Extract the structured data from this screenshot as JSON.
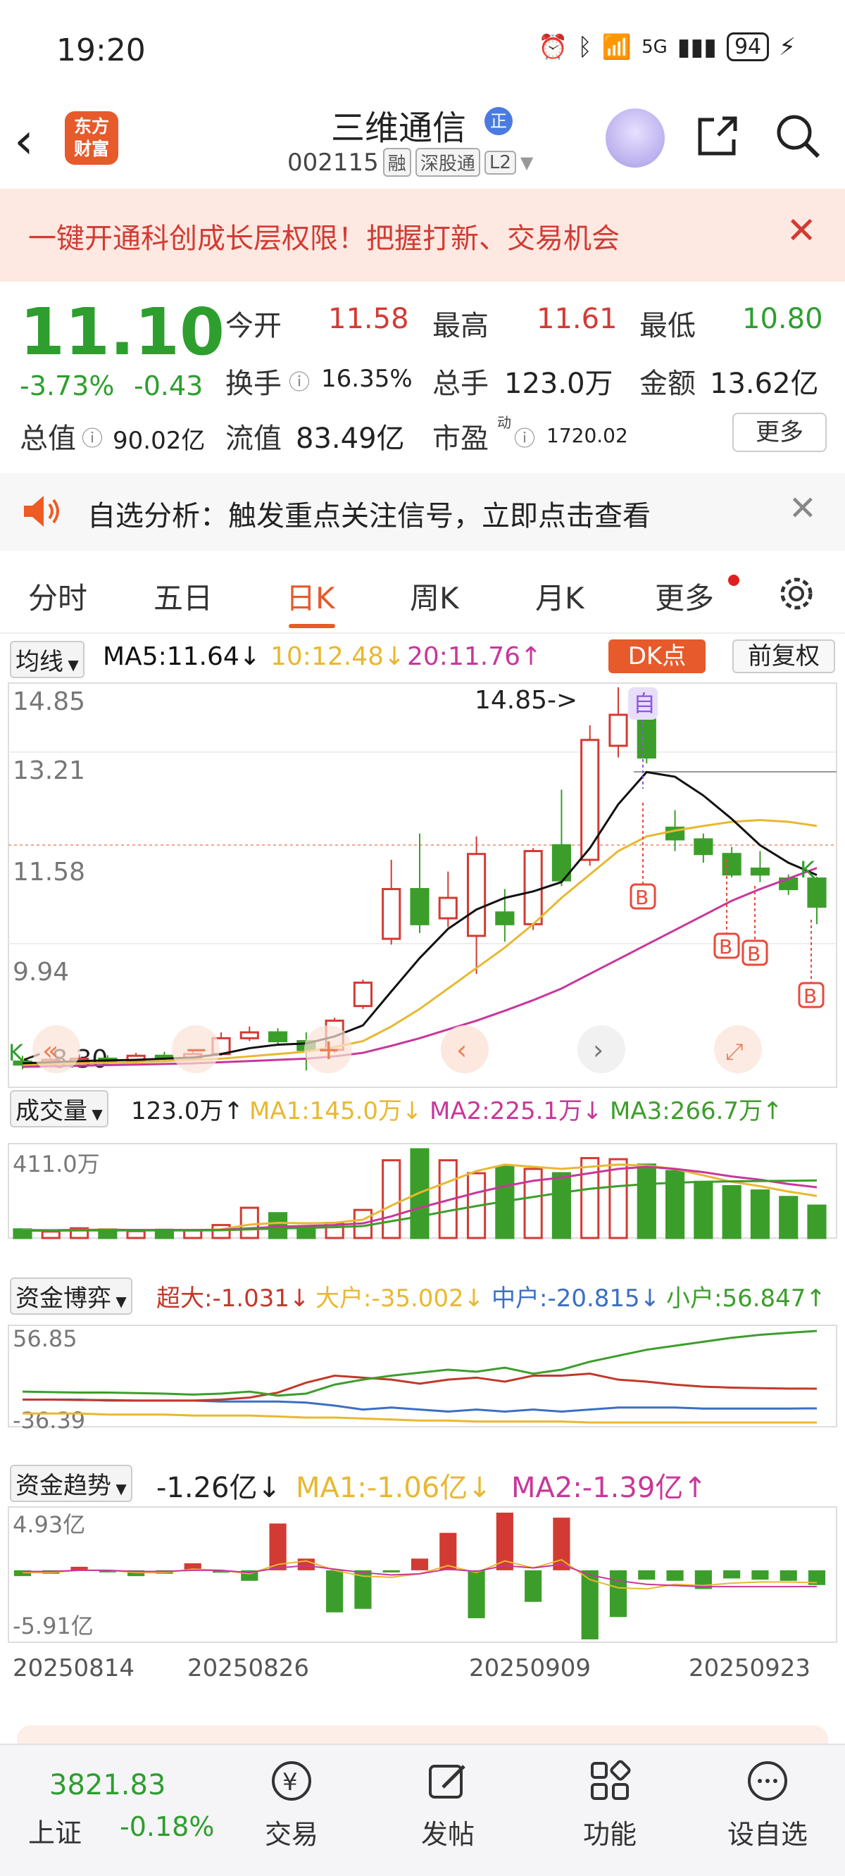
{
  "status_bar": {
    "time": "19:20",
    "network": "5G",
    "battery": "94"
  },
  "header": {
    "back_label": "‹",
    "logo_line1": "东方",
    "logo_line2": "财富",
    "stock_name": "三维通信",
    "zheng_badge": "正",
    "stock_code": "002115",
    "tag_rong": "融",
    "tag_sgt": "深股通",
    "tag_l2": "L2"
  },
  "banner": {
    "text": "一键开通科创成长层权限！把握打新、交易机会",
    "close": "✕"
  },
  "quote": {
    "price": "11.10",
    "change_pct": "-3.73%",
    "change_abs": "-0.43",
    "open_label": "今开",
    "open": "11.58",
    "high_label": "最高",
    "high": "11.61",
    "low_label": "最低",
    "low": "10.80",
    "turnover_label": "换手",
    "turnover": "16.35%",
    "volume_label": "总手",
    "volume": "123.0万",
    "amount_label": "金额",
    "amount": "13.62亿",
    "mktcap_label": "总值",
    "mktcap": "90.02亿",
    "float_label": "流值",
    "float_cap": "83.49亿",
    "pe_label": "市盈",
    "pe_sup": "动",
    "pe": "1720.02",
    "more": "更多"
  },
  "notice": {
    "text": "自选分析：触发重点关注信号，立即点击查看",
    "close": "✕"
  },
  "tabs": [
    {
      "label": "分时"
    },
    {
      "label": "五日"
    },
    {
      "label": "日K"
    },
    {
      "label": "周K"
    },
    {
      "label": "月K"
    },
    {
      "label": "更多"
    }
  ],
  "ma_bar": {
    "selector": "均线",
    "ma5": "MA5:11.64↓",
    "ma10": "10:12.48↓",
    "ma20": "20:11.76↑",
    "dk": "DK点",
    "fuquan": "前复权"
  },
  "kline": {
    "y_ticks": [
      "14.85",
      "13.21",
      "11.58",
      "9.94"
    ],
    "high_note": "14.85->",
    "low_note": "<-8.30",
    "self_tag": "自",
    "k_tag": "K",
    "b_tag": "B",
    "colors": {
      "up": "#d23b34",
      "down": "#3c9e2a",
      "ma5": "#111111",
      "ma10": "#e8b830",
      "ma20": "#c8379a"
    }
  },
  "volume": {
    "selector": "成交量",
    "current": "123.0万↑",
    "ma1": "MA1:145.0万↓",
    "ma2": "MA2:225.1万↓",
    "ma3": "MA3:266.7万↑",
    "y_top": "411.0万"
  },
  "fund_game": {
    "selector": "资金博弈",
    "super": "超大:-1.031↓",
    "big": "大户:-35.002↓",
    "mid": "中户:-20.815↓",
    "small": "小户:56.847↑",
    "y_top": "56.85",
    "y_bottom": "-36.39"
  },
  "fund_trend": {
    "selector": "资金趋势",
    "current": "-1.26亿↓",
    "ma1": "MA1:-1.06亿↓",
    "ma2": "MA2:-1.39亿↑",
    "y_top": "4.93亿",
    "y_bottom": "-5.91亿"
  },
  "x_dates": [
    "20250814",
    "20250826",
    "20250909",
    "20250923"
  ],
  "bottom_nav": {
    "index_value": "3821.83",
    "index_name": "上证",
    "index_pct": "-0.18%",
    "items": [
      {
        "label": "交易"
      },
      {
        "label": "发帖"
      },
      {
        "label": "功能"
      },
      {
        "label": "设自选"
      }
    ]
  },
  "chart_data": {
    "type": "candlestick",
    "candles": [
      {
        "o": 8.45,
        "c": 8.4,
        "h": 8.55,
        "l": 8.32
      },
      {
        "o": 8.42,
        "c": 8.48,
        "h": 8.52,
        "l": 8.35
      },
      {
        "o": 8.45,
        "c": 8.5,
        "h": 8.58,
        "l": 8.4
      },
      {
        "o": 8.5,
        "c": 8.47,
        "h": 8.56,
        "l": 8.4
      },
      {
        "o": 8.47,
        "c": 8.55,
        "h": 8.6,
        "l": 8.42
      },
      {
        "o": 8.55,
        "c": 8.52,
        "h": 8.62,
        "l": 8.45
      },
      {
        "o": 8.52,
        "c": 8.58,
        "h": 8.66,
        "l": 8.48
      },
      {
        "o": 8.58,
        "c": 8.85,
        "h": 8.95,
        "l": 8.55
      },
      {
        "o": 8.85,
        "c": 8.95,
        "h": 9.05,
        "l": 8.8
      },
      {
        "o": 8.95,
        "c": 8.8,
        "h": 9.02,
        "l": 8.72
      },
      {
        "o": 8.8,
        "c": 8.65,
        "h": 8.95,
        "l": 8.3
      },
      {
        "o": 8.65,
        "c": 9.15,
        "h": 9.2,
        "l": 8.6
      },
      {
        "o": 9.4,
        "c": 9.8,
        "h": 9.85,
        "l": 9.35
      },
      {
        "o": 10.55,
        "c": 11.4,
        "h": 11.9,
        "l": 10.45
      },
      {
        "o": 11.4,
        "c": 10.8,
        "h": 12.35,
        "l": 10.65
      },
      {
        "o": 10.9,
        "c": 11.25,
        "h": 11.7,
        "l": 10.75
      },
      {
        "o": 10.6,
        "c": 12.0,
        "h": 12.3,
        "l": 9.95
      },
      {
        "o": 11.0,
        "c": 10.8,
        "h": 11.4,
        "l": 10.5
      },
      {
        "o": 10.8,
        "c": 12.05,
        "h": 12.1,
        "l": 10.7
      },
      {
        "o": 12.15,
        "c": 11.55,
        "h": 13.1,
        "l": 11.45
      },
      {
        "o": 11.9,
        "c": 13.95,
        "h": 14.2,
        "l": 11.8
      },
      {
        "o": 13.85,
        "c": 14.38,
        "h": 14.85,
        "l": 13.65
      },
      {
        "o": 14.3,
        "c": 13.65,
        "h": 14.55,
        "l": 13.55
      },
      {
        "o": 12.45,
        "c": 12.25,
        "h": 12.75,
        "l": 12.05
      },
      {
        "o": 12.25,
        "c": 12.0,
        "h": 12.35,
        "l": 11.85
      },
      {
        "o": 12.0,
        "c": 11.65,
        "h": 12.12,
        "l": 11.6
      },
      {
        "o": 11.75,
        "c": 11.65,
        "h": 12.05,
        "l": 11.52
      },
      {
        "o": 11.58,
        "c": 11.4,
        "h": 11.65,
        "l": 11.3
      },
      {
        "o": 11.58,
        "c": 11.1,
        "h": 11.61,
        "l": 10.8
      }
    ],
    "ma5": [
      8.42,
      8.44,
      8.46,
      8.47,
      8.48,
      8.5,
      8.52,
      8.58,
      8.68,
      8.74,
      8.76,
      8.88,
      9.07,
      9.65,
      10.22,
      10.72,
      11.05,
      11.25,
      11.36,
      11.52,
      12.1,
      12.85,
      13.4,
      13.32,
      13.0,
      12.6,
      12.15,
      11.85,
      11.64
    ],
    "ma10": [
      8.4,
      8.41,
      8.42,
      8.43,
      8.44,
      8.46,
      8.48,
      8.5,
      8.54,
      8.58,
      8.62,
      8.7,
      8.8,
      9.05,
      9.35,
      9.7,
      10.05,
      10.4,
      10.8,
      11.25,
      11.65,
      12.05,
      12.3,
      12.4,
      12.48,
      12.55,
      12.58,
      12.55,
      12.48
    ],
    "ma20": [
      8.36,
      8.37,
      8.38,
      8.39,
      8.4,
      8.41,
      8.42,
      8.44,
      8.46,
      8.48,
      8.5,
      8.54,
      8.6,
      8.72,
      8.85,
      9.0,
      9.15,
      9.32,
      9.5,
      9.7,
      9.95,
      10.2,
      10.45,
      10.7,
      10.95,
      11.2,
      11.4,
      11.58,
      11.76
    ],
    "volume": [
      40,
      30,
      45,
      40,
      32,
      38,
      35,
      60,
      140,
      115,
      50,
      70,
      130,
      360,
      411,
      360,
      300,
      330,
      320,
      300,
      370,
      365,
      340,
      310,
      260,
      240,
      220,
      190,
      150
    ],
    "vol_ma1": [
      38,
      36,
      38,
      39,
      37,
      36,
      36,
      40,
      62,
      70,
      68,
      70,
      85,
      150,
      210,
      260,
      310,
      340,
      330,
      320,
      330,
      340,
      335,
      320,
      290,
      260,
      240,
      215,
      195
    ],
    "vol_ma2": [
      36,
      36,
      37,
      37,
      37,
      37,
      37,
      38,
      45,
      52,
      56,
      60,
      68,
      100,
      140,
      175,
      210,
      240,
      265,
      280,
      300,
      320,
      330,
      320,
      305,
      285,
      270,
      250,
      235
    ],
    "vol_ma3": [
      34,
      34,
      35,
      35,
      35,
      35,
      35,
      36,
      40,
      44,
      47,
      50,
      55,
      78,
      100,
      125,
      148,
      170,
      190,
      210,
      228,
      240,
      250,
      256,
      260,
      262,
      264,
      265,
      266.7
    ],
    "fund_small": [
      -4,
      -4.5,
      -5,
      -5,
      -5.5,
      -6,
      -7,
      -6,
      -4,
      -8,
      -6,
      3,
      8,
      12,
      15,
      18,
      16,
      20,
      14,
      18,
      26,
      32,
      38,
      42,
      46,
      50,
      53,
      55,
      56.85
    ],
    "fund_super": [
      -12,
      -12,
      -12.5,
      -12.5,
      -13,
      -13,
      -13,
      -12,
      -10,
      -5,
      5,
      12,
      10,
      8,
      4,
      8,
      10,
      6,
      12,
      12,
      14,
      8,
      6,
      3,
      1,
      0,
      -0.5,
      -1,
      -1.031
    ],
    "fund_mid": [
      -12,
      -12,
      -12,
      -13,
      -13,
      -13,
      -13,
      -14,
      -14,
      -14,
      -15,
      -18,
      -22,
      -20,
      -22,
      -24,
      -22,
      -24,
      -22,
      -24,
      -22,
      -20,
      -20,
      -20,
      -21,
      -21,
      -21,
      -21,
      -20.815
    ],
    "fund_big": [
      -26,
      -26,
      -26,
      -27,
      -27,
      -27,
      -28,
      -28,
      -28,
      -29,
      -30,
      -30,
      -31,
      -32,
      -33,
      -33,
      -34,
      -34,
      -34,
      -34,
      -35,
      -35,
      -35,
      -35,
      -35,
      -35,
      -35,
      -35,
      -35.002
    ],
    "fund_trend": [
      -0.5,
      -0.3,
      0.3,
      -0.1,
      -0.5,
      -0.3,
      0.6,
      -0.2,
      -0.9,
      4.0,
      1.0,
      -3.6,
      -3.3,
      -0.1,
      1.0,
      3.2,
      -4.1,
      4.93,
      -2.7,
      4.5,
      -5.91,
      -4.0,
      -0.8,
      -0.9,
      -1.6,
      -0.7,
      -0.8,
      -0.9,
      -1.26
    ],
    "fund_ma1": [
      -0.2,
      -0.2,
      0,
      0,
      -0.2,
      -0.2,
      0.1,
      0,
      -0.3,
      0.5,
      0.8,
      0,
      -0.5,
      -0.6,
      -0.3,
      0.4,
      -0.2,
      0.8,
      0.2,
      0.9,
      -0.8,
      -1.5,
      -1.6,
      -1.2,
      -1.3,
      -1.1,
      -1.0,
      -1.0,
      -1.06
    ],
    "fund_ma2": [
      -0.1,
      -0.1,
      0,
      0,
      -0.1,
      -0.1,
      0,
      0,
      -0.2,
      0.2,
      0.4,
      0.1,
      -0.2,
      -0.4,
      -0.3,
      0.1,
      -0.1,
      0.4,
      0.2,
      0.5,
      -0.4,
      -0.9,
      -1.2,
      -1.3,
      -1.4,
      -1.4,
      -1.4,
      -1.4,
      -1.39
    ],
    "x_labels": [
      "20250814",
      "20250826",
      "20250909",
      "20250923"
    ],
    "y_range_price": [
      8.3,
      14.85
    ],
    "y_range_volume": [
      0,
      411
    ],
    "y_range_fund_game": [
      -36.39,
      56.85
    ],
    "y_range_fund_trend": [
      -5.91,
      4.93
    ]
  }
}
